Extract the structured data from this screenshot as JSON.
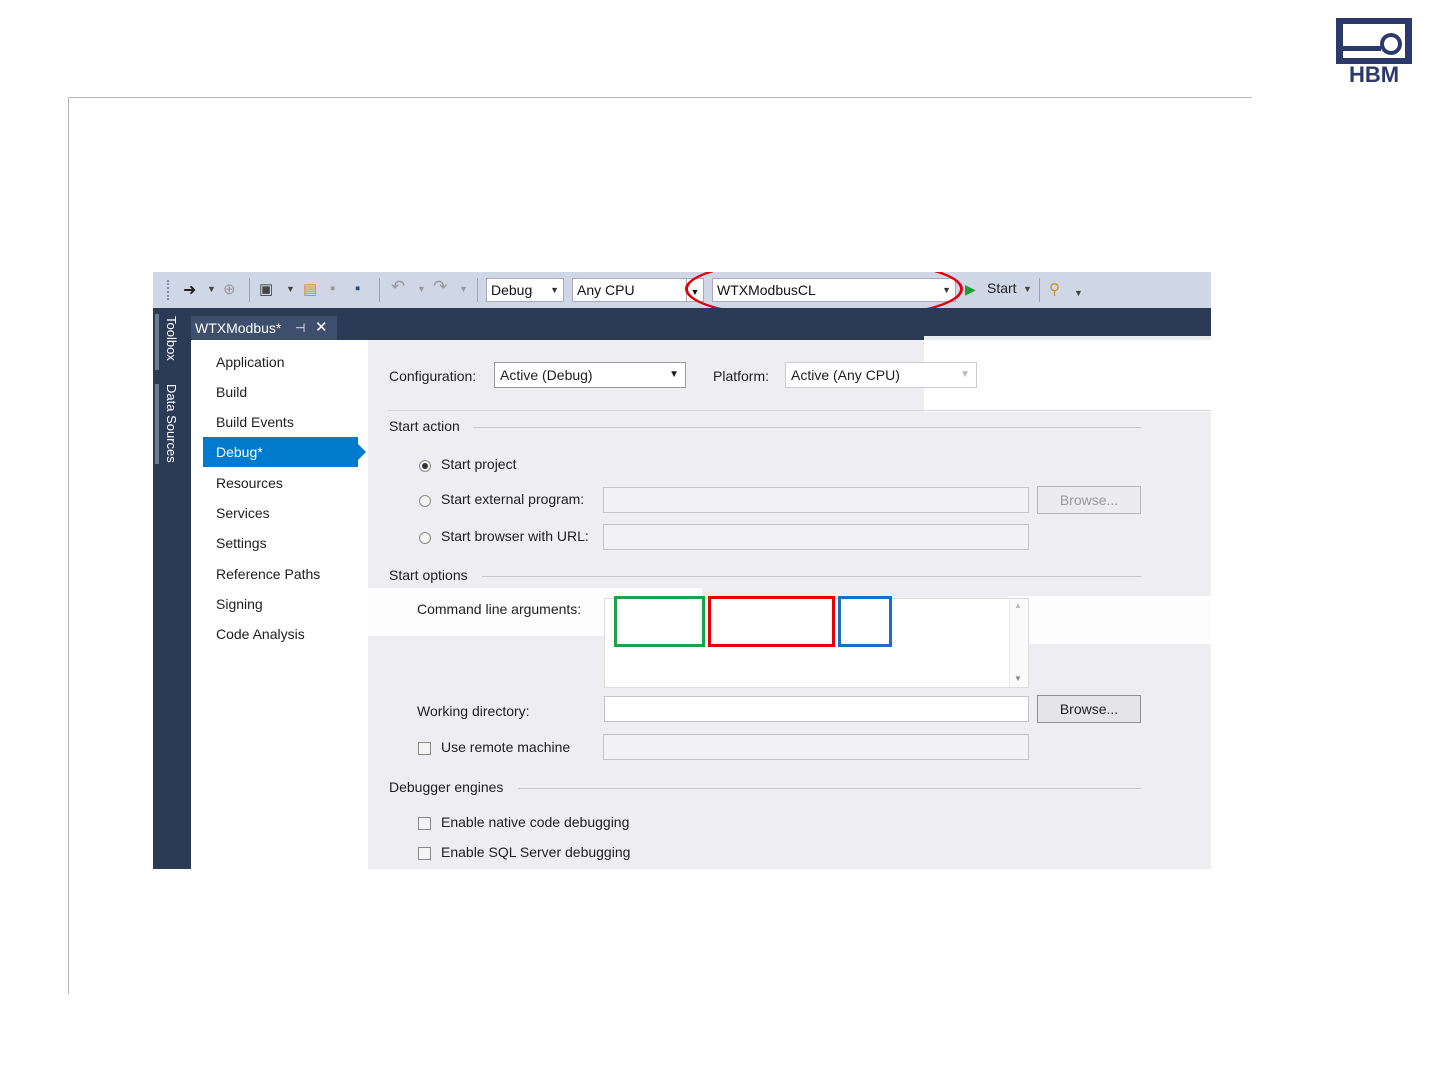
{
  "logo": {
    "text": "HBM"
  },
  "toolbar": {
    "config_combo": "Debug",
    "platform_combo": "Any CPU",
    "startup_project_combo": "WTXModbusCL",
    "start_label": "Start"
  },
  "side_tabs": {
    "toolbox": "Toolbox",
    "data_sources": "Data Sources"
  },
  "doc_tab": {
    "title": "WTXModbus*"
  },
  "nav": {
    "items": [
      {
        "label": "Application"
      },
      {
        "label": "Build"
      },
      {
        "label": "Build Events"
      },
      {
        "label": "Debug*"
      },
      {
        "label": "Resources"
      },
      {
        "label": "Services"
      },
      {
        "label": "Settings"
      },
      {
        "label": "Reference Paths"
      },
      {
        "label": "Signing"
      },
      {
        "label": "Code Analysis"
      }
    ],
    "active_index": 3
  },
  "config": {
    "configuration_label": "Configuration:",
    "configuration_value": "Active (Debug)",
    "platform_label": "Platform:",
    "platform_value": "Active (Any CPU)"
  },
  "start_action": {
    "title": "Start action",
    "start_project": "Start project",
    "start_external": "Start external program:",
    "start_browser": "Start browser with URL:",
    "browse": "Browse...",
    "selected": "start_project"
  },
  "start_options": {
    "title": "Start options",
    "cmd_args_label": "Command line arguments:",
    "working_dir_label": "Working directory:",
    "browse": "Browse...",
    "use_remote": "Use remote machine"
  },
  "debugger_engines": {
    "title": "Debugger engines",
    "native": "Enable native code debugging",
    "sql": "Enable SQL Server debugging"
  },
  "annotations": {
    "ellipse_color": "#e3000b",
    "box_colors": [
      "#1aa34a",
      "#e3000b",
      "#1a6fc4"
    ]
  }
}
